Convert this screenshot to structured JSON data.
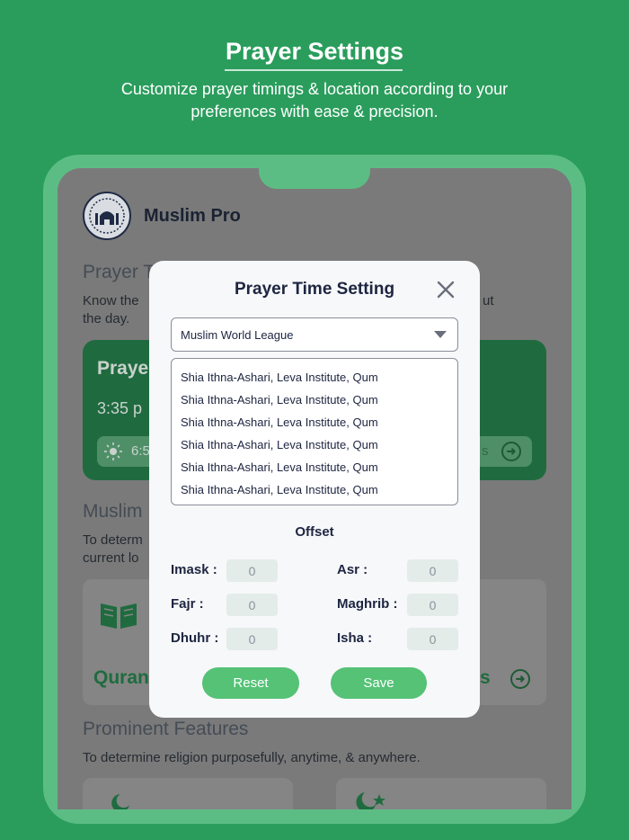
{
  "promo": {
    "title": "Prayer Settings",
    "subtitle": "Customize prayer timings & location according to your preferences with ease & precision."
  },
  "app": {
    "name": "Muslim Pro",
    "section1_title": "Prayer T",
    "section1_desc_line1": "Know the",
    "section1_desc_right": "ut",
    "section1_desc_line2": "the day.",
    "prayer_card_title": "Praye",
    "prayer_card_time": "3:35 p",
    "prayer_card_sun_time": "6:5",
    "prayer_card_right_text": "s",
    "section2_title": "Muslim",
    "section2_desc_line1": "To determ",
    "section2_desc_line2": "current lo",
    "quran_label": "Quran",
    "quran_right_text": "s",
    "features_title": "Prominent Features",
    "features_desc": "To determine religion purposefully, anytime, & anywhere."
  },
  "modal": {
    "title": "Prayer Time Setting",
    "method_selected": "Muslim World League",
    "method_options": [
      "Shia Ithna-Ashari, Leva Institute, Qum",
      "Shia Ithna-Ashari, Leva Institute, Qum",
      "Shia Ithna-Ashari, Leva Institute, Qum",
      "Shia Ithna-Ashari, Leva Institute, Qum",
      "Shia Ithna-Ashari, Leva Institute, Qum",
      "Shia Ithna-Ashari, Leva Institute, Qum"
    ],
    "offset_label": "Offset",
    "offsets": {
      "imask": {
        "label": "Imask :",
        "value": "0"
      },
      "fajr": {
        "label": "Fajr :",
        "value": "0"
      },
      "dhuhr": {
        "label": "Dhuhr :",
        "value": "0"
      },
      "asr": {
        "label": "Asr :",
        "value": "0"
      },
      "maghrib": {
        "label": "Maghrib :",
        "value": "0"
      },
      "isha": {
        "label": "Isha :",
        "value": "0"
      }
    },
    "reset_label": "Reset",
    "save_label": "Save"
  },
  "colors": {
    "background": "#2a9d5c",
    "accent_button": "#55c276",
    "modal_bg": "#f7f8fa",
    "title_text": "#1d2540"
  }
}
